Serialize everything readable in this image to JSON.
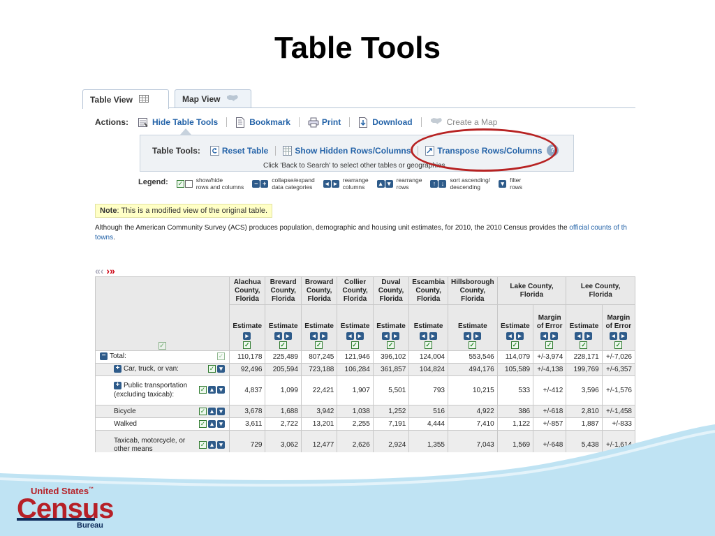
{
  "slide": {
    "title": "Table Tools"
  },
  "tabs": [
    {
      "label": "Table View",
      "icon": "grid-icon",
      "active": true
    },
    {
      "label": "Map View",
      "icon": "us-map-icon",
      "active": false
    }
  ],
  "actions": {
    "label": "Actions:",
    "items": [
      {
        "label": "Hide Table Tools",
        "icon": "table-tools-icon",
        "enabled": true
      },
      {
        "label": "Bookmark",
        "icon": "bookmark-icon",
        "enabled": true
      },
      {
        "label": "Print",
        "icon": "printer-icon",
        "enabled": true
      },
      {
        "label": "Download",
        "icon": "download-icon",
        "enabled": true
      },
      {
        "label": "Create a Map",
        "icon": "us-map-icon",
        "enabled": false
      }
    ]
  },
  "table_tools": {
    "label": "Table Tools:",
    "items": [
      {
        "label": "Reset Table",
        "icon": "reset-icon"
      },
      {
        "label": "Show Hidden Rows/Columns",
        "icon": "columns-icon"
      },
      {
        "label": "Transpose Rows/Columns",
        "icon": "transpose-icon"
      }
    ],
    "help": "?",
    "note": "Click 'Back to Search' to select other tables or geographies"
  },
  "legend": {
    "label": "Legend:",
    "items": [
      {
        "text1": "show/hide",
        "text2": "rows and columns"
      },
      {
        "text1": "collapse/expand",
        "text2": "data categories"
      },
      {
        "text1": "rearrange",
        "text2": "columns"
      },
      {
        "text1": "rearrange",
        "text2": "rows"
      },
      {
        "text1": "sort ascending/",
        "text2": "descending"
      },
      {
        "text1": "filter",
        "text2": "rows"
      }
    ]
  },
  "note": {
    "bold": "Note",
    "text": ": This is a modified view of the original table."
  },
  "intro": {
    "text": "Although the American Community Survey (ACS) produces population, demographic and housing unit estimates, for 2010, the 2010 Census provides the ",
    "link": "official counts of th",
    "line2_link": "towns",
    "line2_text": "."
  },
  "pager": {
    "prev": "«‹",
    "next": "›»"
  },
  "data_table": {
    "counties": [
      {
        "name": "Alachua County, Florida",
        "cols": [
          "Estimate"
        ]
      },
      {
        "name": "Brevard County, Florida",
        "cols": [
          "Estimate"
        ]
      },
      {
        "name": "Broward County, Florida",
        "cols": [
          "Estimate"
        ]
      },
      {
        "name": "Collier County, Florida",
        "cols": [
          "Estimate"
        ]
      },
      {
        "name": "Duval County, Florida",
        "cols": [
          "Estimate"
        ]
      },
      {
        "name": "Escambia County, Florida",
        "cols": [
          "Estimate"
        ]
      },
      {
        "name": "Hillsborough County, Florida",
        "cols": [
          "Estimate"
        ]
      },
      {
        "name": "Lake County, Florida",
        "cols": [
          "Estimate",
          "Margin of Error"
        ]
      },
      {
        "name": "Lee County, Florida",
        "cols": [
          "Estimate",
          "Margin of Error"
        ]
      }
    ],
    "rows": [
      {
        "label": "Total:",
        "toggle": "−",
        "indent": 0,
        "values": [
          "110,178",
          "225,489",
          "807,245",
          "121,946",
          "396,102",
          "124,004",
          "553,546",
          "114,079",
          "+/-3,974",
          "228,171",
          "+/-7,026"
        ]
      },
      {
        "label": "Car, truck, or van:",
        "toggle": "+",
        "indent": 1,
        "values": [
          "92,496",
          "205,594",
          "723,188",
          "106,284",
          "361,857",
          "104,824",
          "494,176",
          "105,589",
          "+/-4,138",
          "199,769",
          "+/-6,357"
        ]
      },
      {
        "label": "Public transportation (excluding taxicab):",
        "toggle": "+",
        "indent": 1,
        "values": [
          "4,837",
          "1,099",
          "22,421",
          "1,907",
          "5,501",
          "793",
          "10,215",
          "533",
          "+/-412",
          "3,596",
          "+/-1,576"
        ]
      },
      {
        "label": "Bicycle",
        "toggle": "",
        "indent": 1,
        "values": [
          "3,678",
          "1,688",
          "3,942",
          "1,038",
          "1,252",
          "516",
          "4,922",
          "386",
          "+/-618",
          "2,810",
          "+/-1,458"
        ]
      },
      {
        "label": "Walked",
        "toggle": "",
        "indent": 1,
        "values": [
          "3,611",
          "2,722",
          "13,201",
          "2,255",
          "7,191",
          "4,444",
          "7,410",
          "1,122",
          "+/-857",
          "1,887",
          "+/-833"
        ]
      },
      {
        "label": "Taxicab, motorcycle, or other means",
        "toggle": "",
        "indent": 1,
        "values": [
          "729",
          "3,062",
          "12,477",
          "2,626",
          "2,924",
          "1,355",
          "7,043",
          "1,569",
          "+/-648",
          "5,438",
          "+/-1,614"
        ]
      }
    ]
  },
  "footer": {
    "logo_top": "United States",
    "logo_tm": "™",
    "logo_main": "Census",
    "logo_sub": "Bureau"
  },
  "colors": {
    "link": "#2463a8",
    "callout": "#b72222",
    "census_red": "#b62027",
    "census_navy": "#0f2d5c",
    "wave": "#bfe3f3"
  }
}
